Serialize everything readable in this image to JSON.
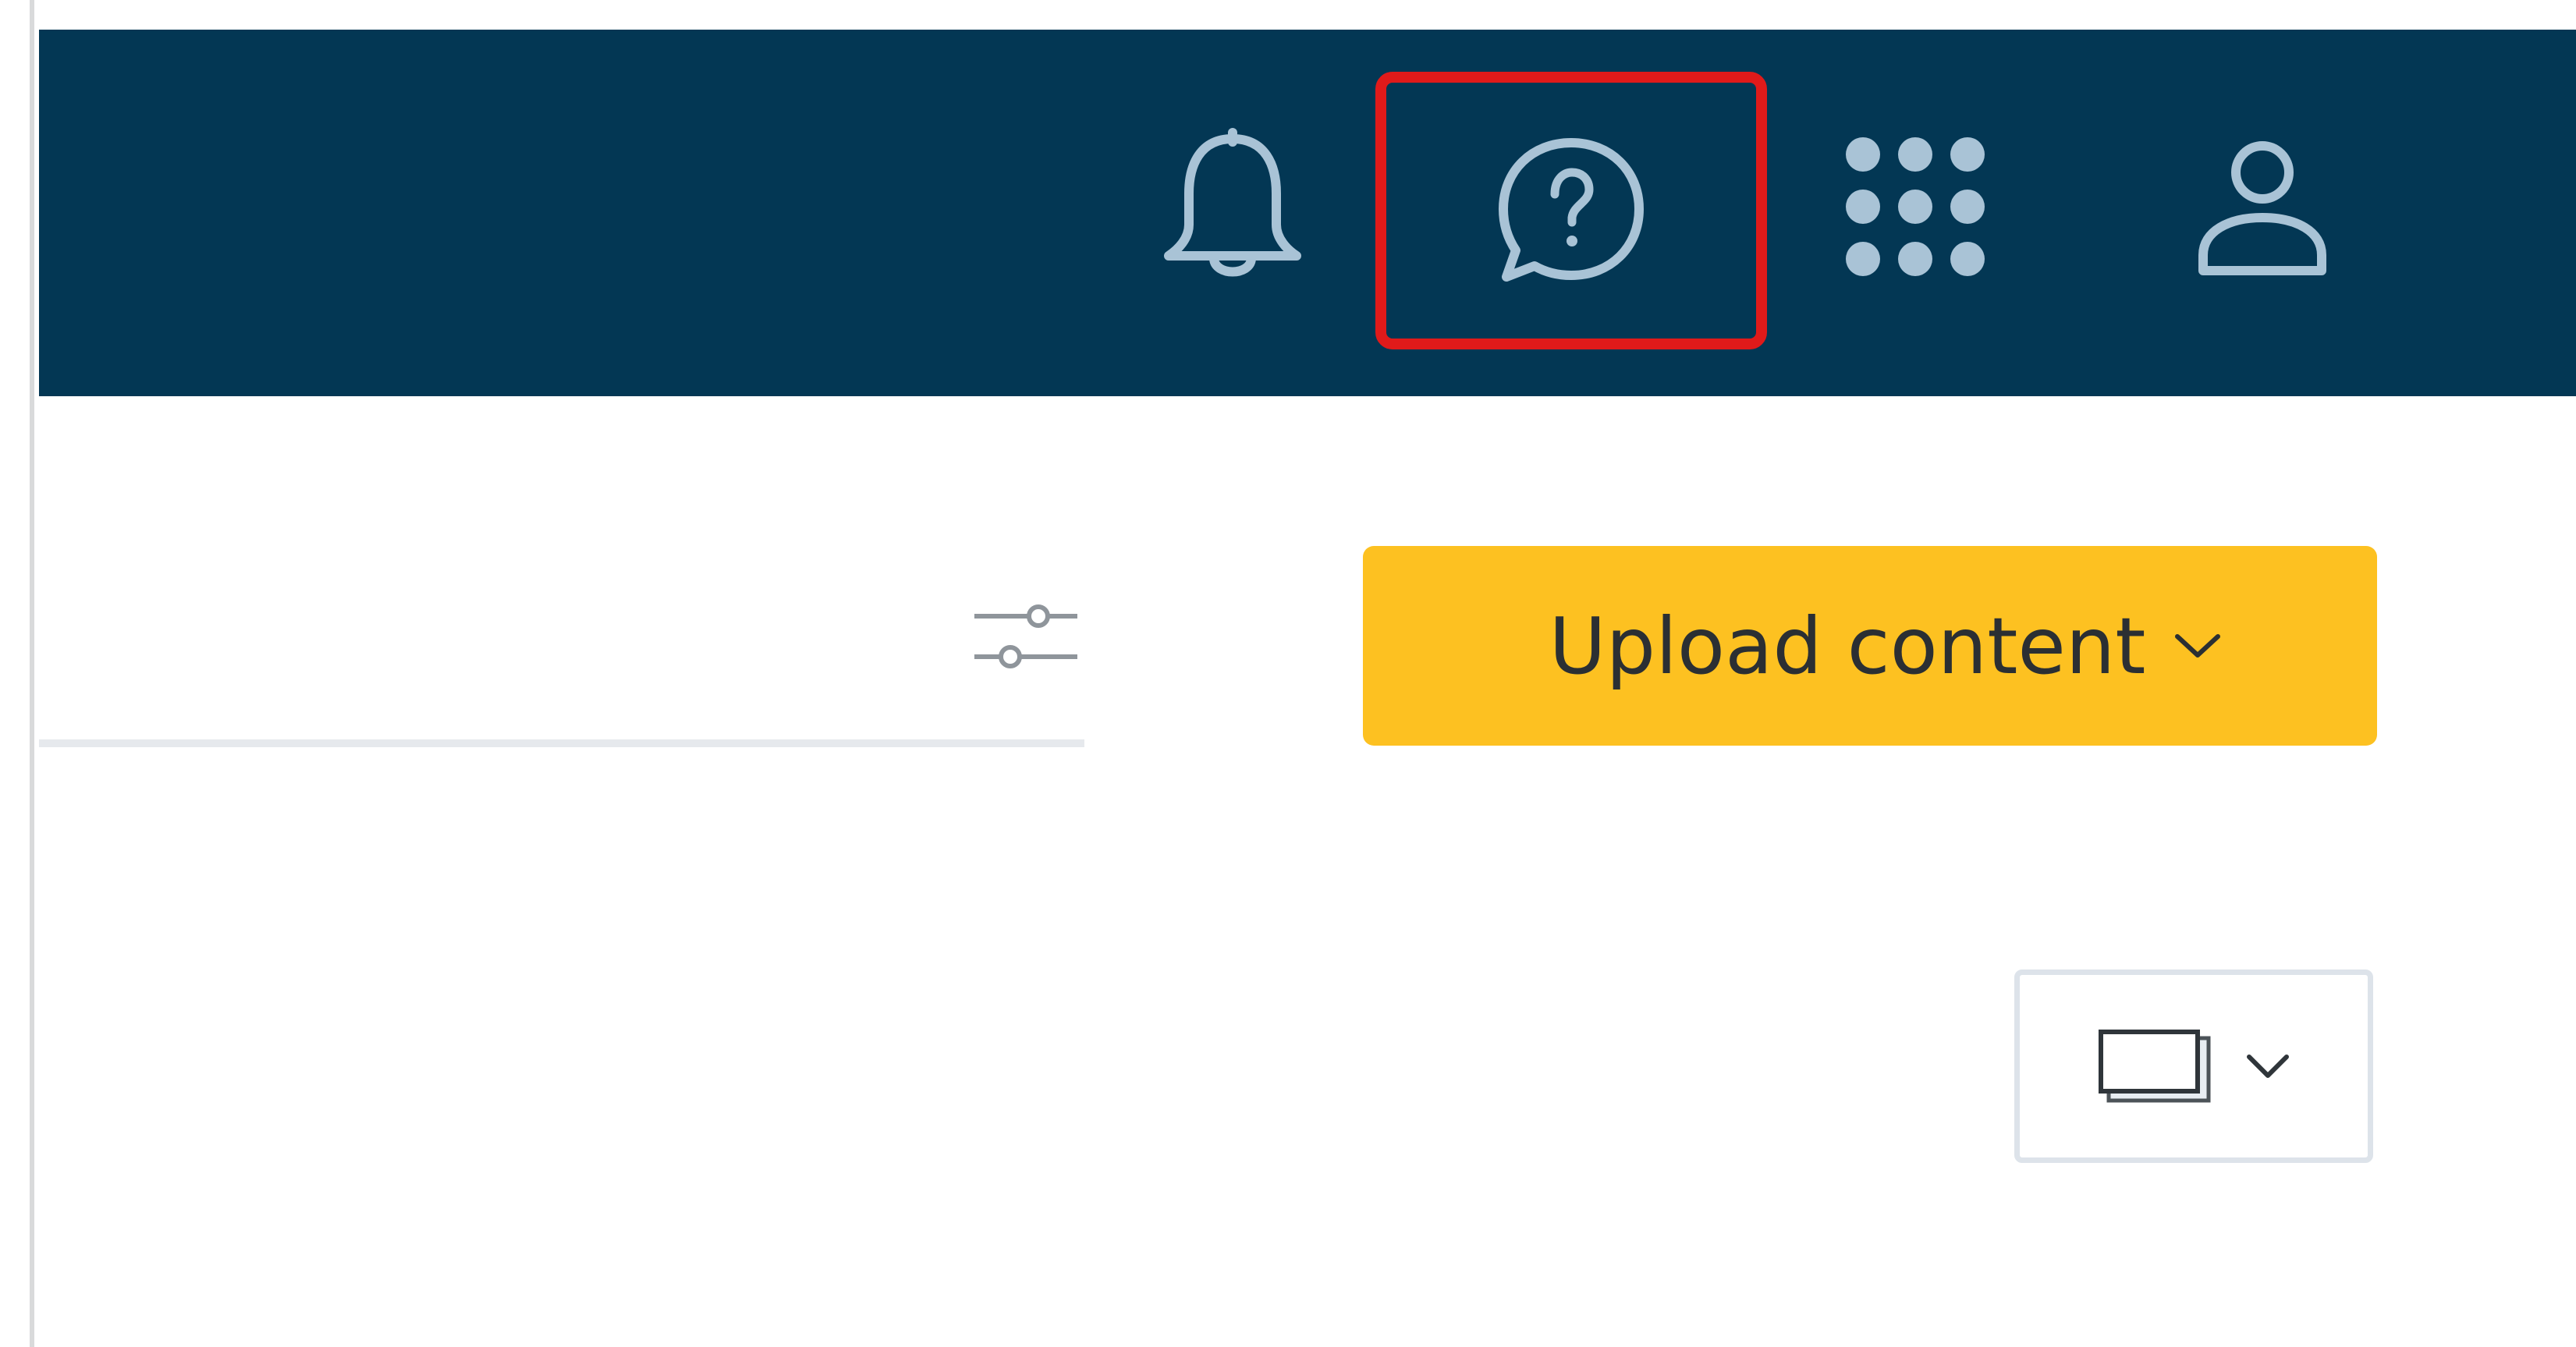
{
  "header": {
    "background": "#033754",
    "icons": {
      "notifications": "bell-icon",
      "help": "help-chat-icon",
      "apps": "app-grid-icon",
      "account": "user-icon"
    },
    "icon_color": "#a9c3d6",
    "highlight_color": "#e01a1a"
  },
  "toolbar": {
    "filter_icon": "sliders-icon",
    "upload_button": {
      "label": "Upload content",
      "background": "#fdc121",
      "icon": "chevron-down-icon"
    },
    "view_selector": {
      "icon": "card-view-icon",
      "chevron": "chevron-down-icon"
    }
  }
}
